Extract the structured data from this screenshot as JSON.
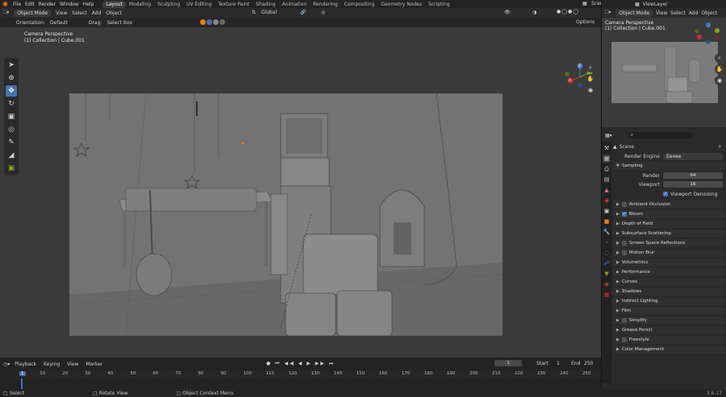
{
  "topbar": {
    "menus": [
      "File",
      "Edit",
      "Render",
      "Window",
      "Help"
    ],
    "workspaces": [
      "Layout",
      "Modeling",
      "Sculpting",
      "UV Editing",
      "Texture Paint",
      "Shading",
      "Animation",
      "Rendering",
      "Compositing",
      "Geometry Nodes",
      "Scripting"
    ],
    "active_workspace": "Layout",
    "scene": "Scene",
    "view_layer": "ViewLayer"
  },
  "toolhdr": {
    "mode": "Object Mode",
    "menus": [
      "View",
      "Select",
      "Add",
      "Object"
    ],
    "transform": "Global"
  },
  "opthdr": {
    "orientation_label": "Orientation:",
    "orientation_value": "Default",
    "drag_label": "Drag:",
    "drag_value": "Select Box",
    "options": "Options"
  },
  "viewport": {
    "camera_title": "Camera Perspective",
    "collection": "(1) Collection | Cube.001"
  },
  "gizmo": {
    "x": "X",
    "y": "Y",
    "z": "Z"
  },
  "mini": {
    "mode": "Object Mode",
    "menus": [
      "View",
      "Select",
      "Add",
      "Object"
    ],
    "camera_title": "Camera Perspective",
    "collection": "(1) Collection | Cube.001"
  },
  "props": {
    "scene_label": "Scene",
    "render_engine_label": "Render Engine",
    "render_engine": "Eevee",
    "sampling": "Sampling",
    "render_label": "Render",
    "render_value": "64",
    "viewport_label": "Viewport",
    "viewport_value": "16",
    "denoise": "Viewport Denoising",
    "sections": [
      {
        "label": "Ambient Occlusion",
        "checkbox": true,
        "checked": false
      },
      {
        "label": "Bloom",
        "checkbox": true,
        "checked": true
      },
      {
        "label": "Depth of Field",
        "checkbox": false,
        "checked": false
      },
      {
        "label": "Subsurface Scattering",
        "checkbox": false,
        "checked": false
      },
      {
        "label": "Screen Space Reflections",
        "checkbox": true,
        "checked": false
      },
      {
        "label": "Motion Blur",
        "checkbox": true,
        "checked": false
      },
      {
        "label": "Volumetrics",
        "checkbox": false,
        "checked": false
      },
      {
        "label": "Performance",
        "checkbox": false,
        "checked": false
      },
      {
        "label": "Curves",
        "checkbox": false,
        "checked": false
      },
      {
        "label": "Shadows",
        "checkbox": false,
        "checked": false
      },
      {
        "label": "Indirect Lighting",
        "checkbox": false,
        "checked": false
      },
      {
        "label": "Film",
        "checkbox": false,
        "checked": false
      },
      {
        "label": "Simplify",
        "checkbox": true,
        "checked": false
      },
      {
        "label": "Grease Pencil",
        "checkbox": false,
        "checked": false
      },
      {
        "label": "Freestyle",
        "checkbox": true,
        "checked": false
      },
      {
        "label": "Color Management",
        "checkbox": false,
        "checked": false
      }
    ]
  },
  "timeline": {
    "menus": [
      "Playback",
      "Keying",
      "View",
      "Marker"
    ],
    "current_frame": "1",
    "start_label": "Start",
    "start": "1",
    "end_label": "End",
    "end": "250",
    "ticks": [
      "1",
      "10",
      "20",
      "30",
      "40",
      "50",
      "60",
      "70",
      "80",
      "90",
      "100",
      "110",
      "120",
      "130",
      "140",
      "150",
      "160",
      "170",
      "180",
      "190",
      "200",
      "210",
      "220",
      "230",
      "240",
      "250"
    ]
  },
  "status": {
    "select": "Select",
    "rotate": "Rotate View",
    "context": "Object Context Menu",
    "version": "3.6.17"
  }
}
